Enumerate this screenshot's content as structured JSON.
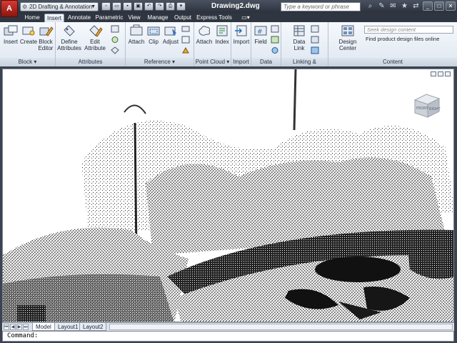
{
  "titlebar": {
    "app_button": "A",
    "workspace": "2D Drafting & Annotation",
    "document_title": "Drawing2.dwg",
    "search_placeholder": "Type a keyword or phrase"
  },
  "tabs": [
    {
      "label": "Home"
    },
    {
      "label": "Insert"
    },
    {
      "label": "Annotate"
    },
    {
      "label": "Parametric"
    },
    {
      "label": "View"
    },
    {
      "label": "Manage"
    },
    {
      "label": "Output"
    },
    {
      "label": "Express Tools"
    }
  ],
  "panels": {
    "block": {
      "title": "Block",
      "insert": "Insert",
      "create": "Create",
      "block_editor_1": "Block",
      "block_editor_2": "Editor"
    },
    "attributes": {
      "title": "Attributes",
      "define_1": "Define",
      "define_2": "Attributes",
      "edit_1": "Edit",
      "edit_2": "Attribute"
    },
    "reference": {
      "title": "Reference",
      "attach": "Attach",
      "clip": "Clip",
      "adjust": "Adjust"
    },
    "point_cloud": {
      "title": "Point Cloud",
      "attach": "Attach",
      "index": "Index"
    },
    "import": {
      "title": "Import",
      "import": "Import"
    },
    "data": {
      "title": "Data",
      "field": "Field"
    },
    "linking": {
      "title": "Linking & Extraction",
      "data_link_1": "Data",
      "data_link_2": "Link"
    },
    "content": {
      "title": "Content",
      "design_center": "Design Center",
      "seek_placeholder": "Seek design content",
      "find_online": "Find product design files online"
    }
  },
  "viewcube": {
    "front": "FRONT",
    "right": "RIGHT"
  },
  "layouts": [
    {
      "label": "Model"
    },
    {
      "label": "Layout1"
    },
    {
      "label": "Layout2"
    }
  ],
  "command": {
    "prompt": "Command:"
  }
}
